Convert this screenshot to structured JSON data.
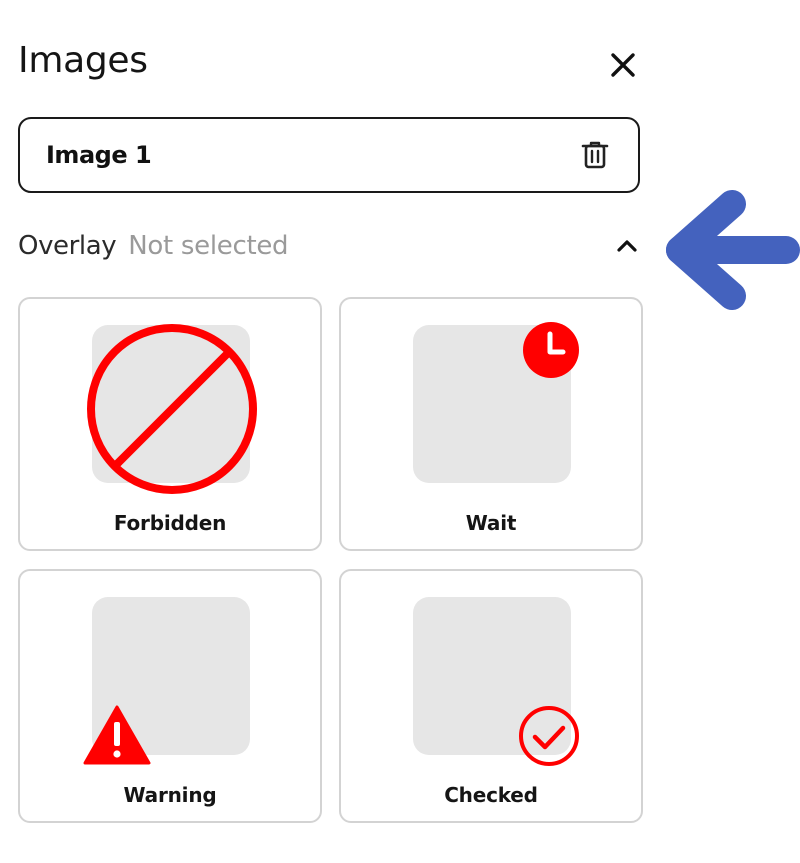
{
  "panel": {
    "title": "Images",
    "close_icon": "close-icon"
  },
  "image_field": {
    "name": "Image 1",
    "delete_icon": "trash-icon"
  },
  "overlay": {
    "label": "Overlay",
    "status": "Not selected",
    "expanded": true,
    "toggle_icon": "chevron-up-icon"
  },
  "options": [
    {
      "label": "Forbidden",
      "icon": "forbidden-icon"
    },
    {
      "label": "Wait",
      "icon": "clock-icon"
    },
    {
      "label": "Warning",
      "icon": "warning-icon"
    },
    {
      "label": "Checked",
      "icon": "check-circle-icon"
    }
  ],
  "annotation": {
    "icon": "arrow-left-icon",
    "color": "#4462be"
  },
  "colors": {
    "accent_red": "#ff0000",
    "card_border": "#d3d3d3",
    "thumb_bg": "#e6e6e6"
  }
}
